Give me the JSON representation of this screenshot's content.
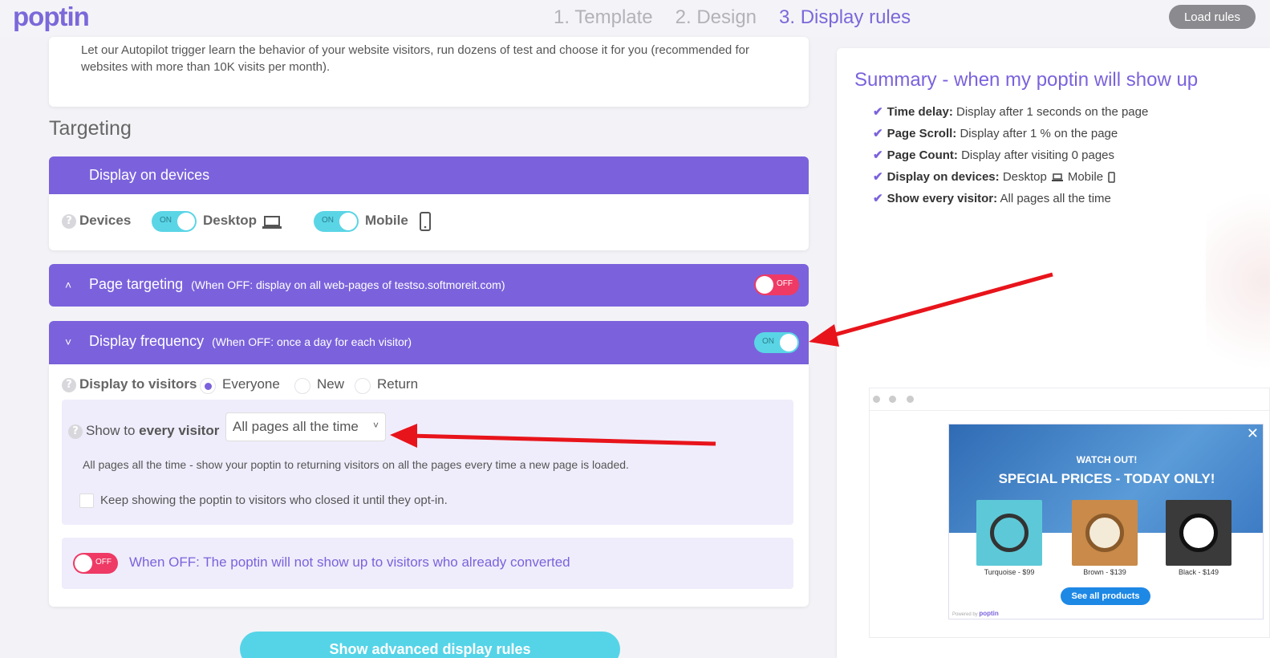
{
  "header": {
    "logo": "poptin",
    "steps": [
      "1. Template",
      "2. Design",
      "3. Display rules"
    ],
    "load_rules": "Load rules"
  },
  "autopilot": {
    "text": "Let our Autopilot trigger learn the behavior of your website visitors, run dozens of test and choose it for you (recommended for websites with more than 10K visits per month)."
  },
  "targeting": {
    "title": "Targeting",
    "devices_panel": {
      "title": "Display on devices",
      "label": "Devices",
      "desktop": {
        "toggle": "ON",
        "label": "Desktop"
      },
      "mobile": {
        "toggle": "ON",
        "label": "Mobile"
      }
    },
    "page_panel": {
      "title": "Page targeting",
      "sub": "(When OFF: display on all web-pages of testso.softmoreit.com)",
      "toggle": "OFF"
    },
    "frequency_panel": {
      "title": "Display frequency",
      "sub": "(When OFF: once a day for each visitor)",
      "toggle": "ON",
      "visitors_label": "Display to visitors",
      "options": [
        "Everyone",
        "New",
        "Return"
      ],
      "selected": "Everyone",
      "show_to_prefix": "Show to",
      "show_to_bold": "every visitor",
      "select_value": "All pages all the time",
      "description": "All pages all the time - show your poptin to returning visitors on all the pages every time a new page is loaded.",
      "keep_showing": "Keep showing the poptin to visitors who closed it until they opt-in.",
      "converted_toggle": "OFF",
      "converted_text": "When OFF: The poptin will not show up to visitors who already converted"
    },
    "advanced_button": "Show advanced display rules"
  },
  "summary": {
    "title": "Summary - when my poptin will show up",
    "items": [
      {
        "label": "Time delay:",
        "value": "Display after 1 seconds on the page"
      },
      {
        "label": "Page Scroll:",
        "value": "Display after 1 % on the page"
      },
      {
        "label": "Page Count:",
        "value": "Display after visiting 0 pages"
      },
      {
        "label": "Display on devices:",
        "value_desktop": "Desktop",
        "value_mobile": "Mobile"
      },
      {
        "label": "Show every visitor:",
        "value": "All pages all the time"
      }
    ]
  },
  "preview": {
    "close": "✕",
    "watch_out": "WATCH OUT!",
    "headline": "SPECIAL PRICES - TODAY ONLY!",
    "products": [
      {
        "caption": "Turquoise - $99",
        "color": "#5dc9d8"
      },
      {
        "caption": "Brown - $139",
        "color": "#c98a4a"
      },
      {
        "caption": "Black - $149",
        "color": "#3a3a3a"
      }
    ],
    "cta": "See all products",
    "powered_prefix": "Powered by",
    "powered_brand": "poptin"
  },
  "colors": {
    "accent": "#7b62dc",
    "toggle_on": "#5ad5e6",
    "toggle_off": "#ee3a65",
    "advanced_button": "#55d4e8",
    "annotation_arrow": "#e8141b"
  }
}
